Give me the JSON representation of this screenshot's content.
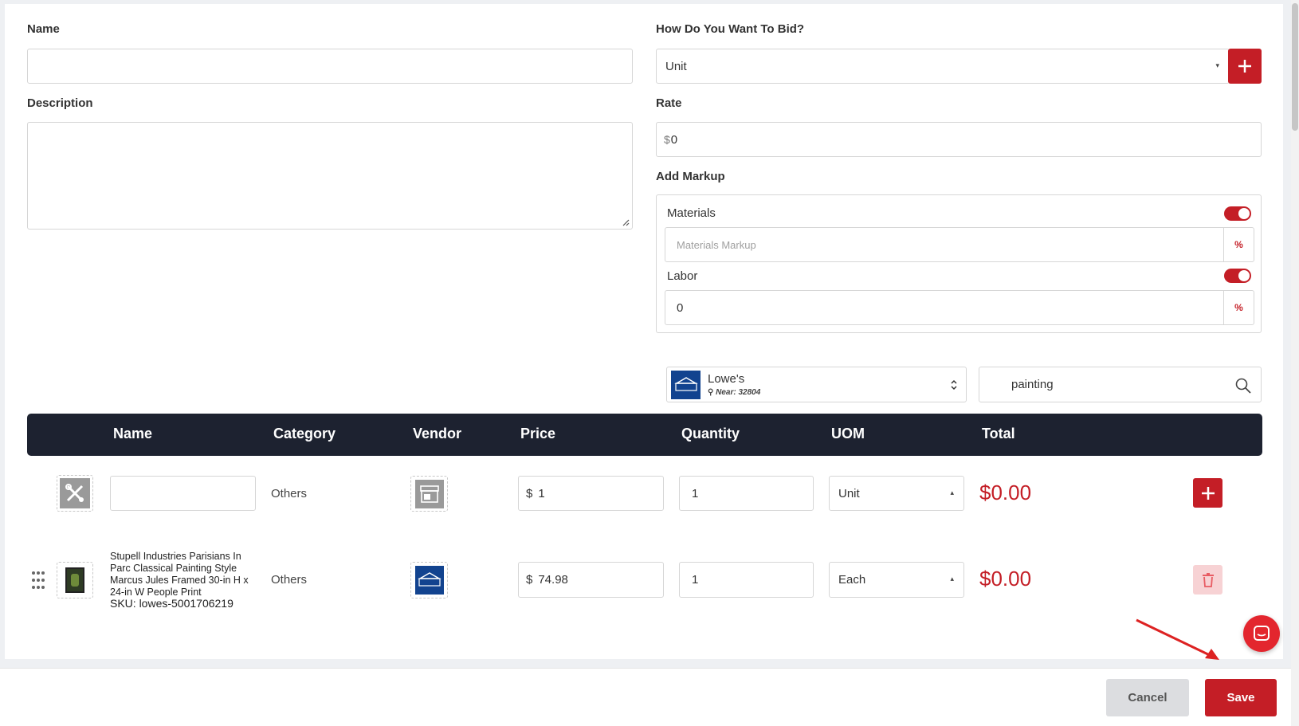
{
  "form": {
    "name_label": "Name",
    "name_value": "",
    "description_label": "Description",
    "description_value": "",
    "bid_label": "How Do You Want To Bid?",
    "bid_value": "Unit",
    "rate_label": "Rate",
    "rate_prefix": "$",
    "rate_value": "0",
    "markup_label": "Add Markup",
    "materials_label": "Materials",
    "materials_placeholder": "Materials Markup",
    "materials_enabled": true,
    "labor_label": "Labor",
    "labor_value": "0",
    "labor_enabled": true,
    "percent_symbol": "%"
  },
  "vendor_select": {
    "name": "Lowe's",
    "near": "Near: 32804",
    "logo_text": "LOWE'S"
  },
  "search": {
    "value": "painting"
  },
  "table": {
    "headers": [
      "Name",
      "Category",
      "Vendor",
      "Price",
      "Quantity",
      "UOM",
      "Total"
    ],
    "rows": [
      {
        "name": "",
        "category": "Others",
        "price_prefix": "$",
        "price": "1",
        "quantity": "1",
        "uom": "Unit",
        "total": "$0.00"
      },
      {
        "name": "Stupell Industries Parisians In Parc Classical Painting Style Marcus Jules Framed 30-in H x 24-in W People Print",
        "sku": "SKU: lowes-5001706219",
        "category": "Others",
        "price_prefix": "$",
        "price": "74.98",
        "quantity": "1",
        "uom": "Each",
        "total": "$0.00"
      }
    ]
  },
  "footer": {
    "cancel_label": "Cancel",
    "save_label": "Save"
  },
  "colors": {
    "accent": "#c41e26",
    "header_bg": "#1d2230",
    "vendor_blue": "#12438f"
  }
}
